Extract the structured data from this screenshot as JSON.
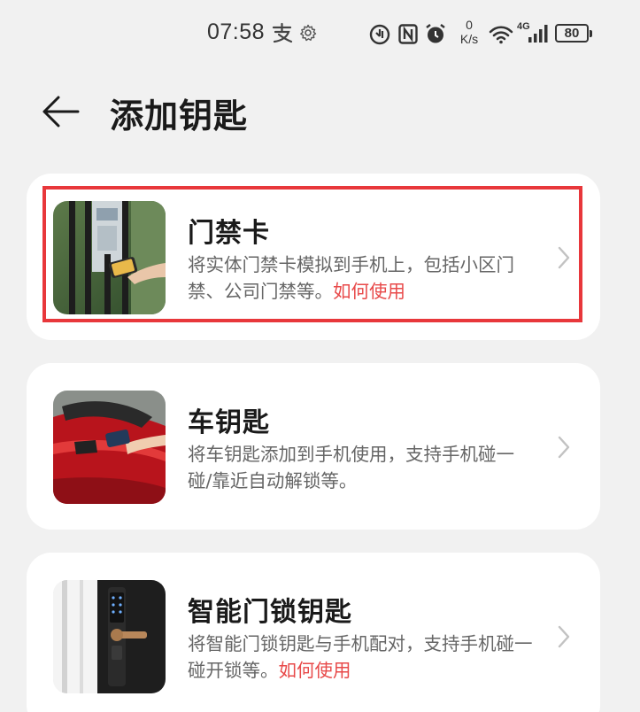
{
  "status_bar": {
    "time": "07:58",
    "net_speed_value": "0",
    "net_speed_unit": "K/s",
    "network_type": "4G",
    "battery": "80",
    "icons": [
      "alipay-icon",
      "gear-icon",
      "data-saver-icon",
      "nfc-icon",
      "alarm-icon",
      "wifi-icon",
      "signal-icon",
      "battery-icon"
    ]
  },
  "header": {
    "title": "添加钥匙"
  },
  "cards": [
    {
      "title": "门禁卡",
      "description": "将实体门禁卡模拟到手机上，包括小区门禁、公司门禁等。",
      "link": "如何使用"
    },
    {
      "title": "车钥匙",
      "description": "将车钥匙添加到手机使用，支持手机碰一碰/靠近自动解锁等。",
      "link": ""
    },
    {
      "title": "智能门锁钥匙",
      "description": "将智能门锁钥匙与手机配对，支持手机碰一碰开锁等。",
      "link": "如何使用"
    }
  ],
  "colors": {
    "background": "#f1f1f1",
    "card": "#ffffff",
    "link": "#e84a4a",
    "highlight": "#e8373b"
  }
}
